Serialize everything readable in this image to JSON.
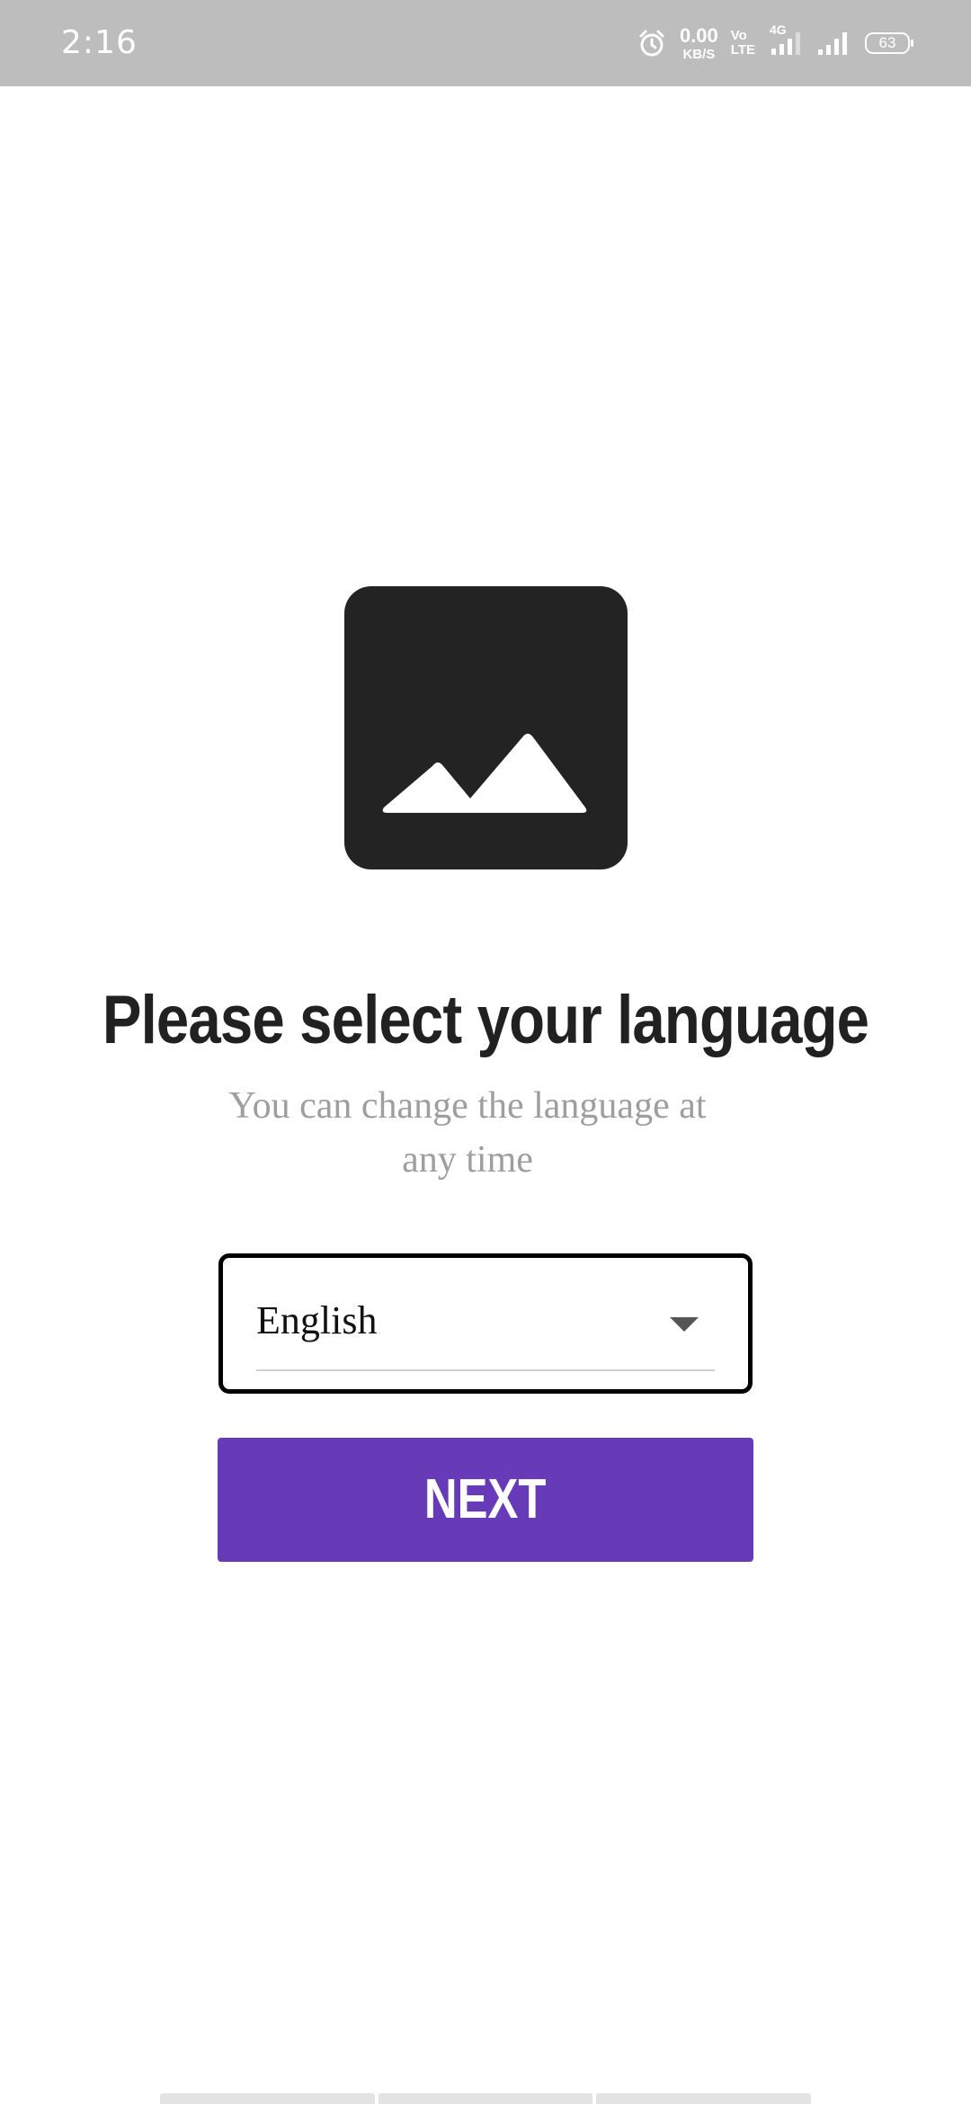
{
  "status_bar": {
    "time": "2:16",
    "net_speed_value": "0.00",
    "net_speed_unit": "KB/S",
    "volte_top": "Vo",
    "volte_bottom": "LTE",
    "network_type": "4G",
    "battery_level": "63",
    "icons": [
      "alarm-icon",
      "volte-icon",
      "signal-4g-icon",
      "signal-icon",
      "battery-icon"
    ]
  },
  "content": {
    "image_icon": "image-placeholder-icon",
    "title": "Please select your language",
    "subtitle": "You can change the language at any time",
    "language_select": {
      "selected": "English",
      "icon": "dropdown-arrow-icon"
    },
    "next_button_label": "NEXT"
  },
  "colors": {
    "accent": "#673ab7",
    "status_bar": "#bdbdbd",
    "title": "#212121",
    "subtitle": "#9e9e9e",
    "placeholder": "#232323"
  }
}
